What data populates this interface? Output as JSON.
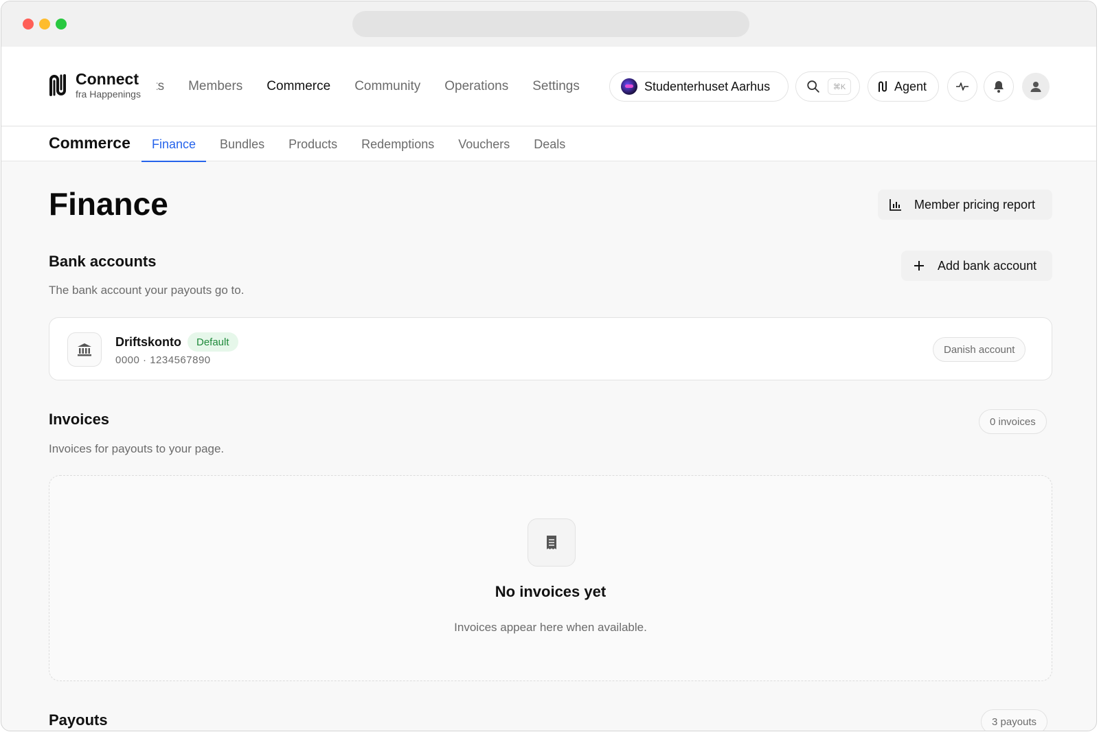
{
  "brand": {
    "name": "Connect",
    "subtitle": "fra Happenings"
  },
  "main_nav": {
    "items": [
      {
        "label": "Events"
      },
      {
        "label": "Members"
      },
      {
        "label": "Commerce",
        "active": true
      },
      {
        "label": "Community"
      },
      {
        "label": "Operations"
      },
      {
        "label": "Settings"
      }
    ]
  },
  "header": {
    "org_name": "Studenterhuset Aarhus",
    "search_shortcut": "⌘K",
    "agent_label": "Agent"
  },
  "sub_nav": {
    "title": "Commerce",
    "tabs": [
      {
        "label": "Finance",
        "active": true
      },
      {
        "label": "Bundles"
      },
      {
        "label": "Products"
      },
      {
        "label": "Redemptions"
      },
      {
        "label": "Vouchers"
      },
      {
        "label": "Deals"
      }
    ]
  },
  "page": {
    "title": "Finance",
    "report_button": "Member pricing report"
  },
  "bank_accounts": {
    "title": "Bank accounts",
    "description": "The bank account your payouts go to.",
    "add_button": "Add bank account",
    "account": {
      "name": "Driftskonto",
      "badge": "Default",
      "number": "0000 · 1234567890",
      "type": "Danish account"
    }
  },
  "invoices": {
    "title": "Invoices",
    "description": "Invoices for payouts to your page.",
    "count": "0 invoices",
    "empty_title": "No invoices yet",
    "empty_desc": "Invoices appear here when available."
  },
  "payouts": {
    "title": "Payouts",
    "count": "3 payouts"
  },
  "colors": {
    "accent": "#2563eb",
    "default_badge_bg": "#e6f7ea",
    "default_badge_text": "#1f8a3b"
  }
}
